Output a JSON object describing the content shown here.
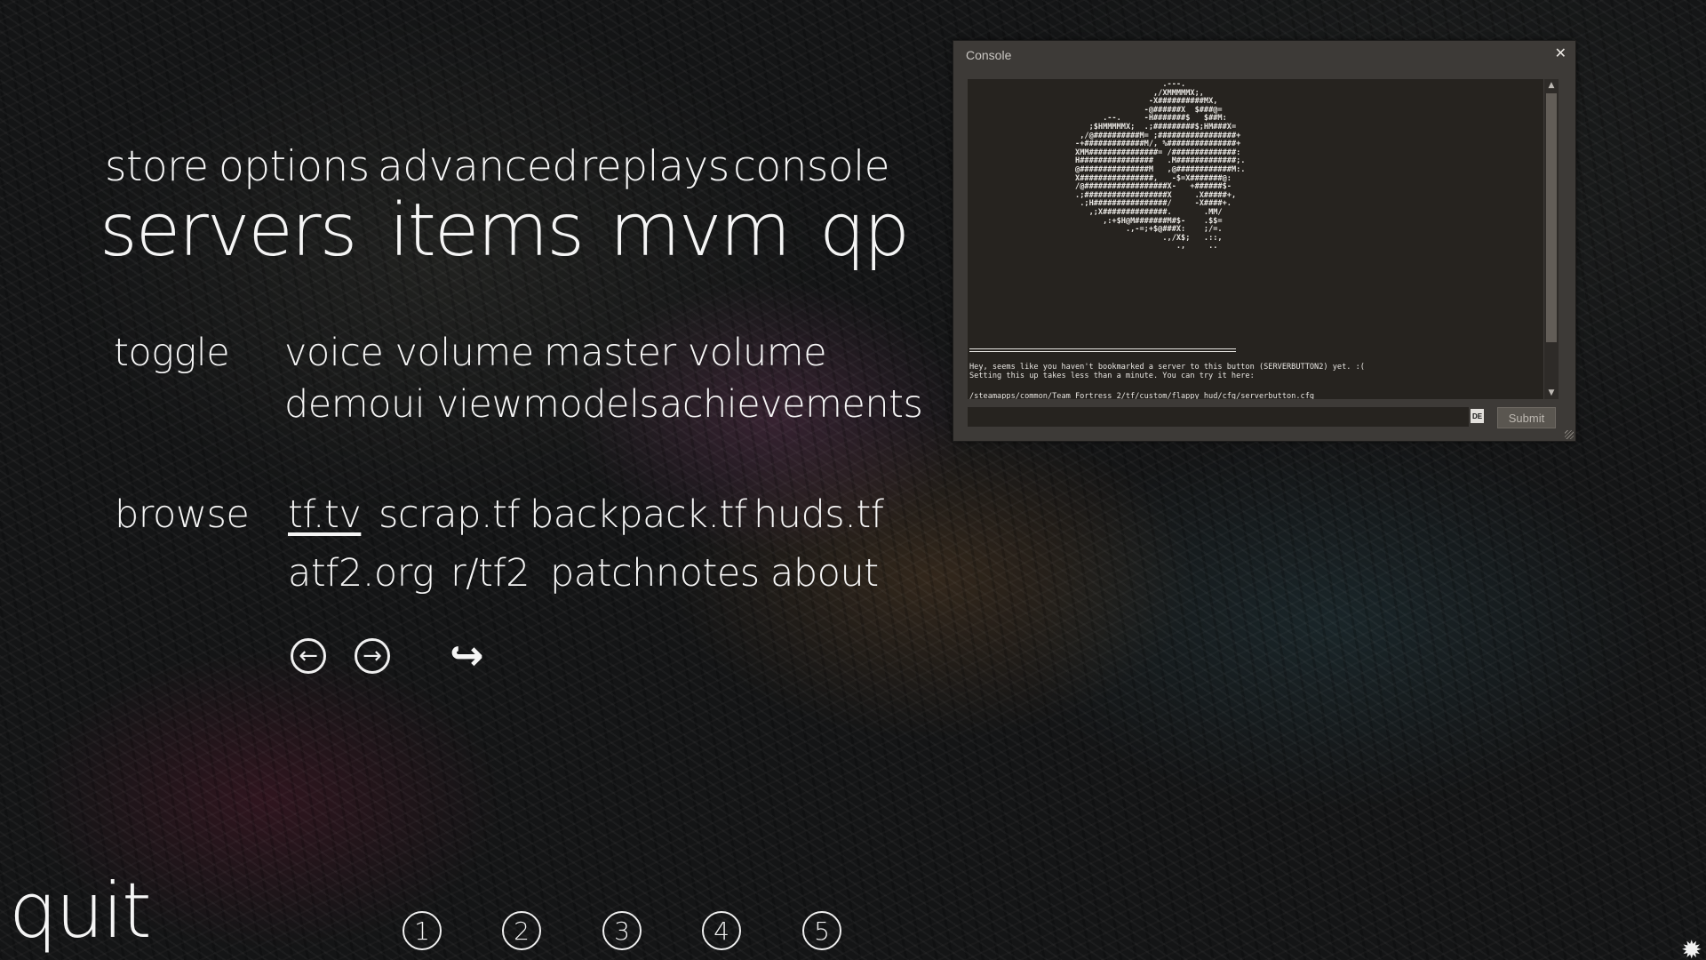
{
  "menu": {
    "top_row": [
      "store",
      "options",
      "advanced",
      "replays",
      "console"
    ],
    "big_row": [
      "servers",
      "items",
      "mvm",
      "qp"
    ]
  },
  "toggle": {
    "label": "toggle",
    "items_row1": [
      "voice volume",
      "master volume"
    ],
    "items_row2": [
      "demoui",
      "viewmodels",
      "achievements"
    ]
  },
  "browse": {
    "label": "browse",
    "links_row1": [
      "tf.tv",
      "scrap.tf",
      "backpack.tf",
      "huds.tf"
    ],
    "links_row2": [
      "atf2.org",
      "r/tf2",
      "patchnotes",
      "about"
    ]
  },
  "nav": {
    "back_icon": "←",
    "forward_icon": "→",
    "reload_icon": "↪"
  },
  "quit_label": "quit",
  "server_buttons": [
    "1",
    "2",
    "3",
    "4",
    "5"
  ],
  "console": {
    "title": "Console",
    "close_glyph": "✕",
    "ascii_art": "                         .---.\n                       ,/XMMMMMX;,\n                      -X##########MX,\n                     -@######X  $###@=\n            .--.     -H#######$   $##M:\n         ;$HMMMMMX;  .;#########$;HM###X=\n       ,/@##########M= ;#################+\n      -+#############M/, %###############+\n      XMM###############= /##############:\n      H################   .M#############;.\n      @###############M   ,@############M:.\n      X################,   -$=X#######@:\n      /@##################X-   +######$-\n      .;##################X     .X#####+,\n       .;H################/     -X####+.\n         ,;X##############.       .MM/\n            ,:+$H@M#######M#$-    .$$=\n                 .,-=;+$@###X:    ;/=.\n                         .,/X$;   .::,\n                            .,     ..",
    "message_lines": [
      "Hey, seems like you haven't bookmarked a server to this button (SERVERBUTTON2) yet. :(",
      "Setting this up takes less than a minute. You can try it here:"
    ],
    "path_line": "/steamapps/common/Team Fortress 2/tf/custom/flappy_hud/cfg/serverbutton.cfg",
    "input_value": "",
    "lang_badge": "DE",
    "submit_label": "Submit"
  },
  "gear_icon": "✹"
}
